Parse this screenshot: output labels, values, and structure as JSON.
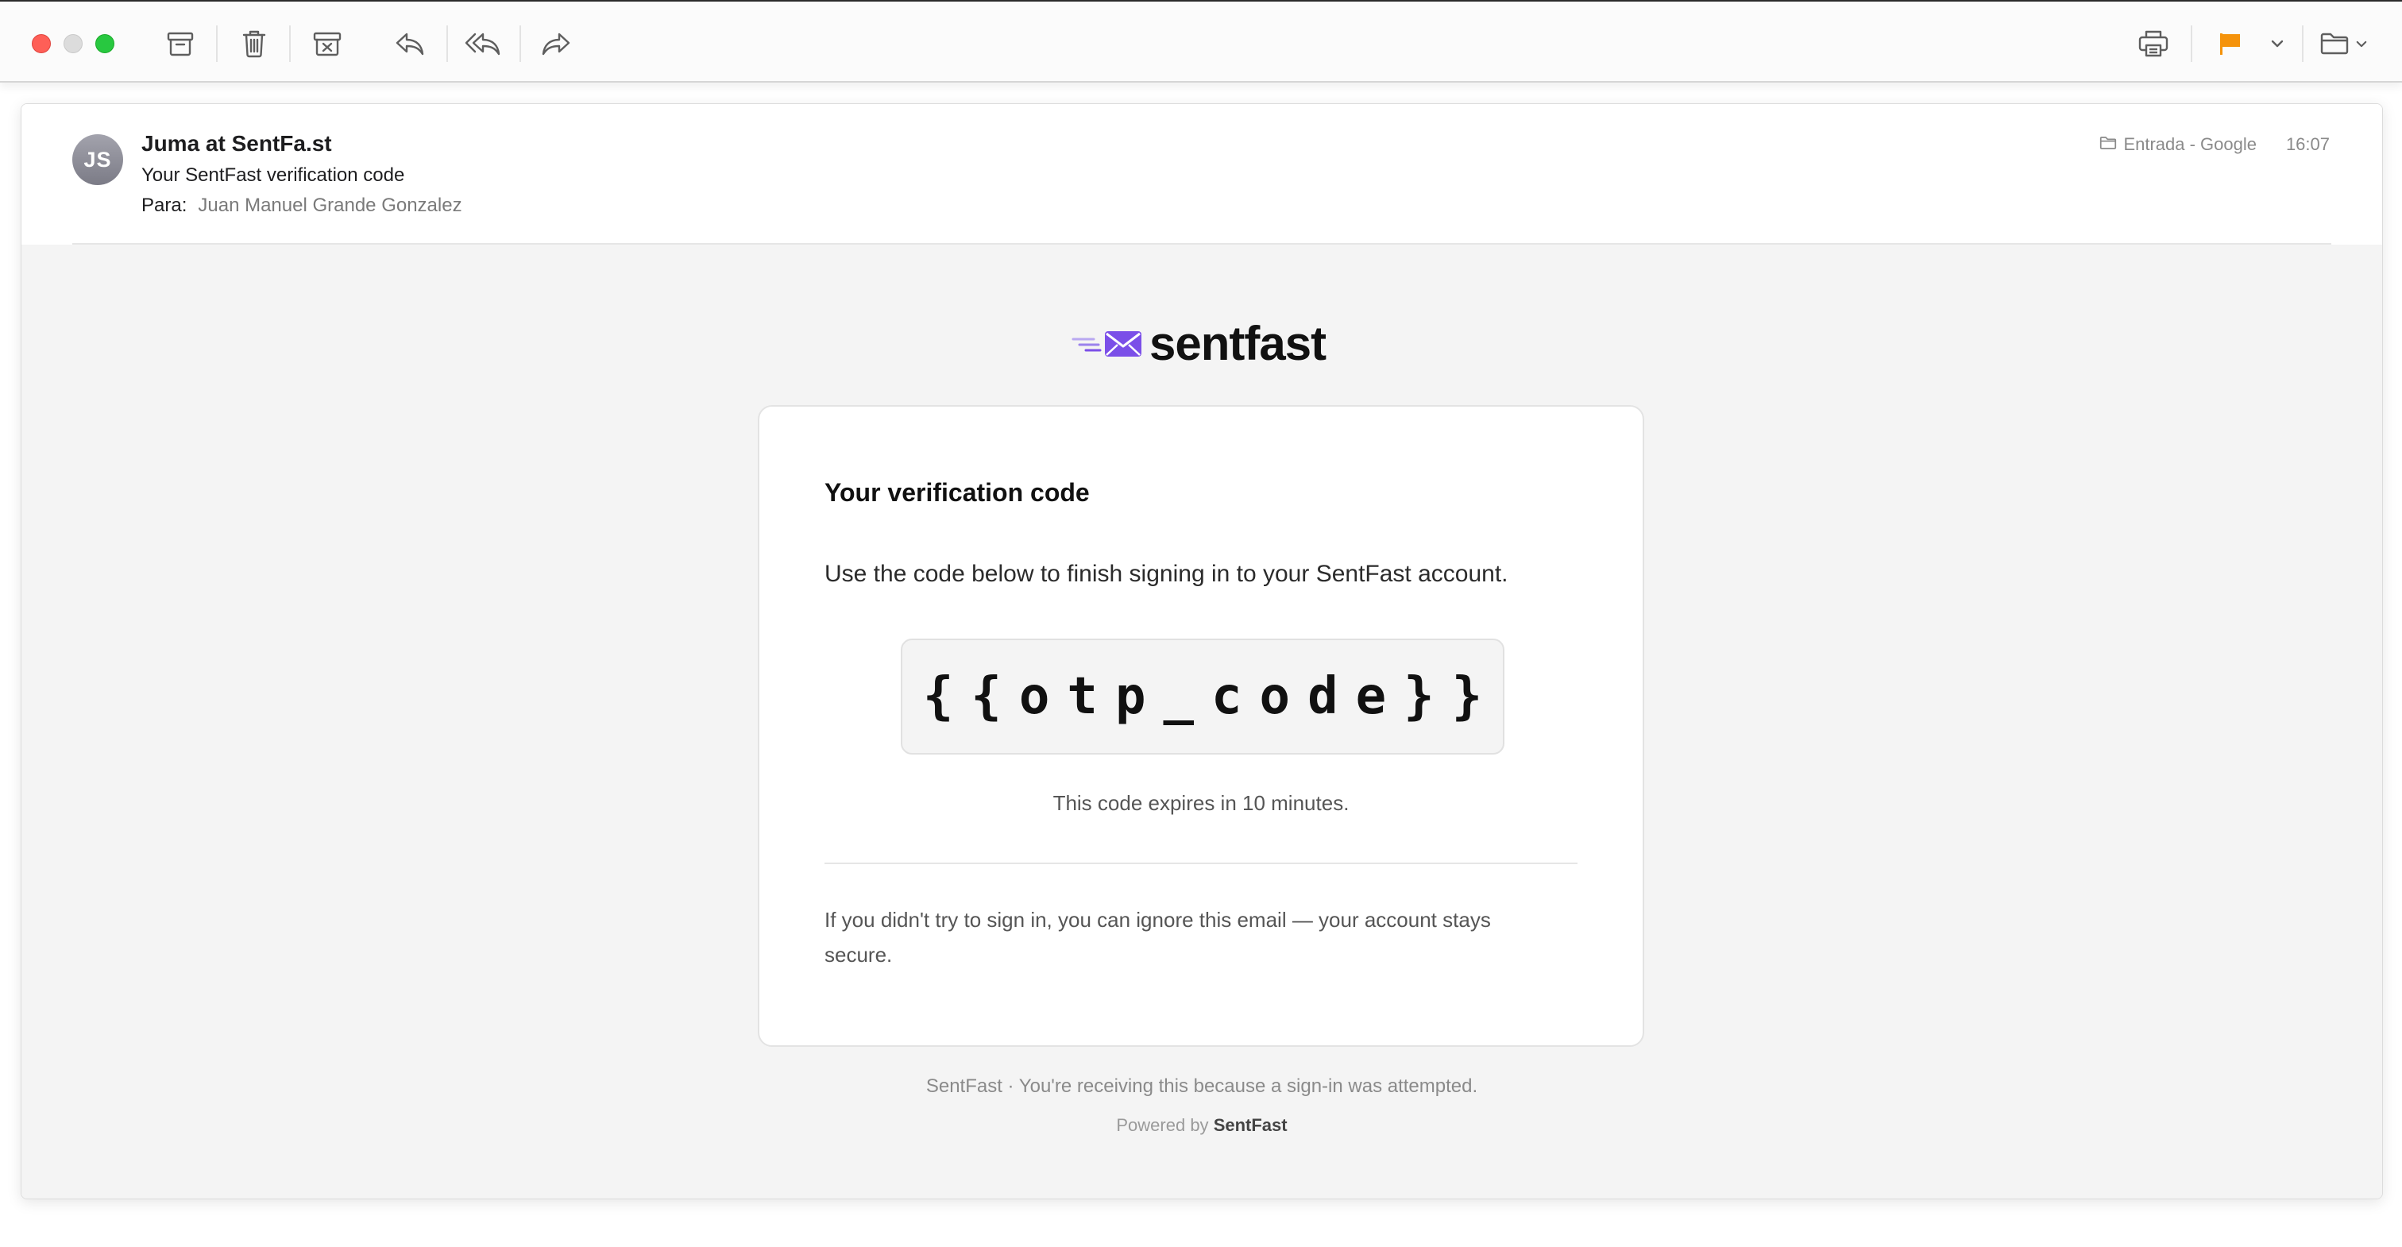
{
  "toolbar": {
    "buttons": [
      "archive-icon",
      "trash-icon",
      "junk-icon",
      "reply-icon",
      "reply-all-icon",
      "forward-icon",
      "print-icon",
      "flag-icon",
      "chevron-down-icon",
      "folder-icon"
    ],
    "flag_color": "#f5930b"
  },
  "message": {
    "avatar_initials": "JS",
    "sender": "Juma at SentFa.st",
    "subject": "Your SentFast verification code",
    "to_label": "Para:",
    "to_name": "Juan Manuel Grande Gonzalez",
    "mailbox": "Entrada - Google",
    "time": "16:07"
  },
  "email": {
    "brand_name": "sentfast",
    "brand_color": "#7b4fe8",
    "card_title": "Your verification code",
    "card_text": "Use the code below to finish signing in to your SentFast account.",
    "code": "{{otp_code}}",
    "expires": "This code expires in 10 minutes.",
    "disclaimer": "If you didn't try to sign in, you can ignore this email — your account stays secure.",
    "footer": "SentFast · You're receiving this because a sign-in was attempted.",
    "powered_by_label": "Powered by",
    "powered_by_name": "SentFast"
  }
}
